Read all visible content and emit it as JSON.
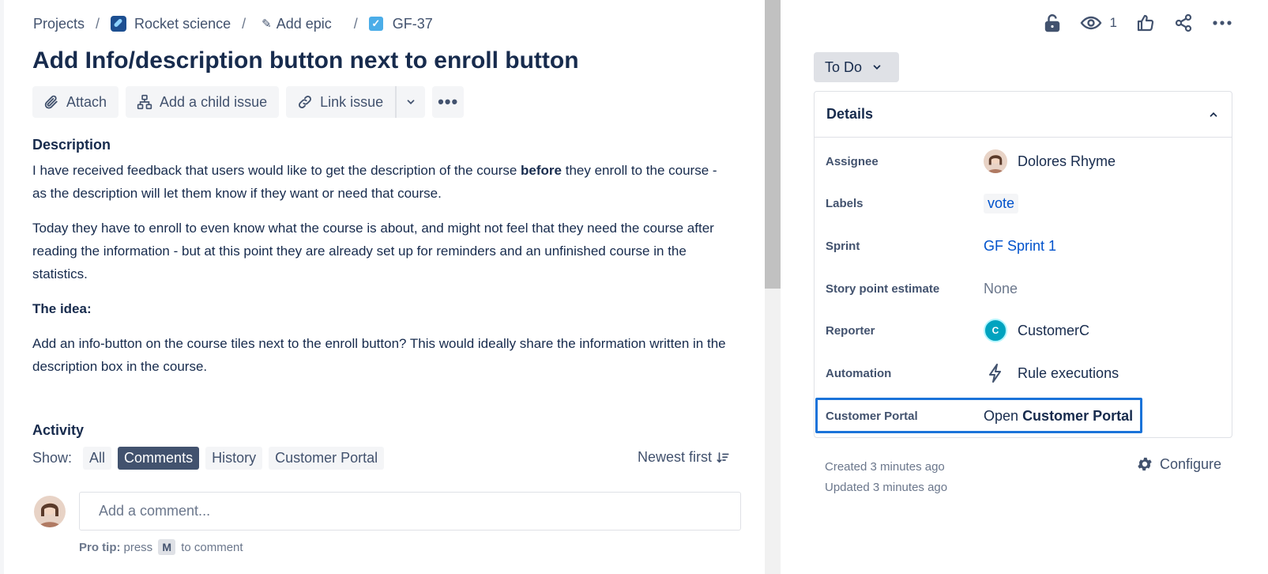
{
  "breadcrumb": {
    "projects": "Projects",
    "separator": "/",
    "project": "Rocket science",
    "epic": "Add epic",
    "issue_key": "GF-37"
  },
  "issue": {
    "title": "Add Info/description button next to enroll button"
  },
  "toolbar": {
    "attach": "Attach",
    "add_child": "Add a child issue",
    "link_issue": "Link issue",
    "more": "•••"
  },
  "description": {
    "heading": "Description",
    "p1_before": "I have received feedback that users would like to get the description of the course ",
    "p1_bold": "before",
    "p1_after": " they enroll to the course - as the description will let them know if they want or need that course.",
    "p2": "Today they have to enroll to even know what the course is about, and might not feel that they need the course after reading the information - but at this point they are already set up for reminders and an unfinished course in the statistics.",
    "idea_heading": "The idea:",
    "p3": "Add an info-button on the course tiles next to the enroll button? This would ideally share the information written in the description box in the course."
  },
  "activity": {
    "heading": "Activity",
    "show_label": "Show:",
    "filters": [
      "All",
      "Comments",
      "History",
      "Customer Portal"
    ],
    "active_filter": "Comments",
    "sort": "Newest first",
    "comment_placeholder": "Add a comment...",
    "protip_label": "Pro tip:",
    "protip_press": "press",
    "protip_key": "M",
    "protip_suffix": "to comment"
  },
  "top_actions": {
    "watch_count": "1"
  },
  "status": {
    "label": "To Do"
  },
  "details": {
    "heading": "Details",
    "assignee_label": "Assignee",
    "assignee": "Dolores Rhyme",
    "labels_label": "Labels",
    "label_value": "vote",
    "sprint_label": "Sprint",
    "sprint": "GF Sprint 1",
    "story_points_label": "Story point estimate",
    "story_points": "None",
    "reporter_label": "Reporter",
    "reporter_initial": "C",
    "reporter": "CustomerC",
    "automation_label": "Automation",
    "automation": "Rule executions",
    "customer_portal_label": "Customer Portal",
    "customer_portal_open": "Open",
    "customer_portal_link": "Customer Portal"
  },
  "meta": {
    "created": "Created 3 minutes ago",
    "updated": "Updated 3 minutes ago",
    "configure": "Configure"
  },
  "colors": {
    "text": "#172b4d",
    "subtle": "#42526e",
    "link": "#0052cc",
    "highlight_outline": "#1a73d9",
    "active_pill": "#42526e"
  },
  "icons": {
    "attach": "paperclip-icon",
    "child": "hierarchy-icon",
    "link": "link-icon",
    "lock": "unlock-icon",
    "watch": "eye-icon",
    "vote": "thumbs-up-icon",
    "share": "share-icon",
    "automation": "lightning-icon",
    "configure": "gear-icon"
  }
}
